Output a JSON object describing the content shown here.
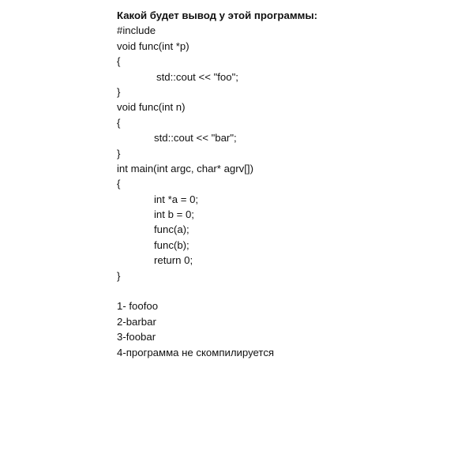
{
  "question": {
    "title": "Какой будет вывод у этой программы:"
  },
  "code": {
    "lines": [
      "#include",
      "void func(int *p)",
      "{",
      "std::cout << \"foo\";",
      "}",
      "void func(int n)",
      "{",
      "std::cout << \"bar\";",
      "}",
      "int main(int argc, char* agrv[])",
      "{",
      "int *a = 0;",
      "int b = 0;",
      "func(a);",
      "func(b);",
      "return 0;",
      "}"
    ]
  },
  "answers": [
    "1- foofoo",
    "2-barbar",
    "3-foobar",
    "4-программа не скомпилируется"
  ]
}
